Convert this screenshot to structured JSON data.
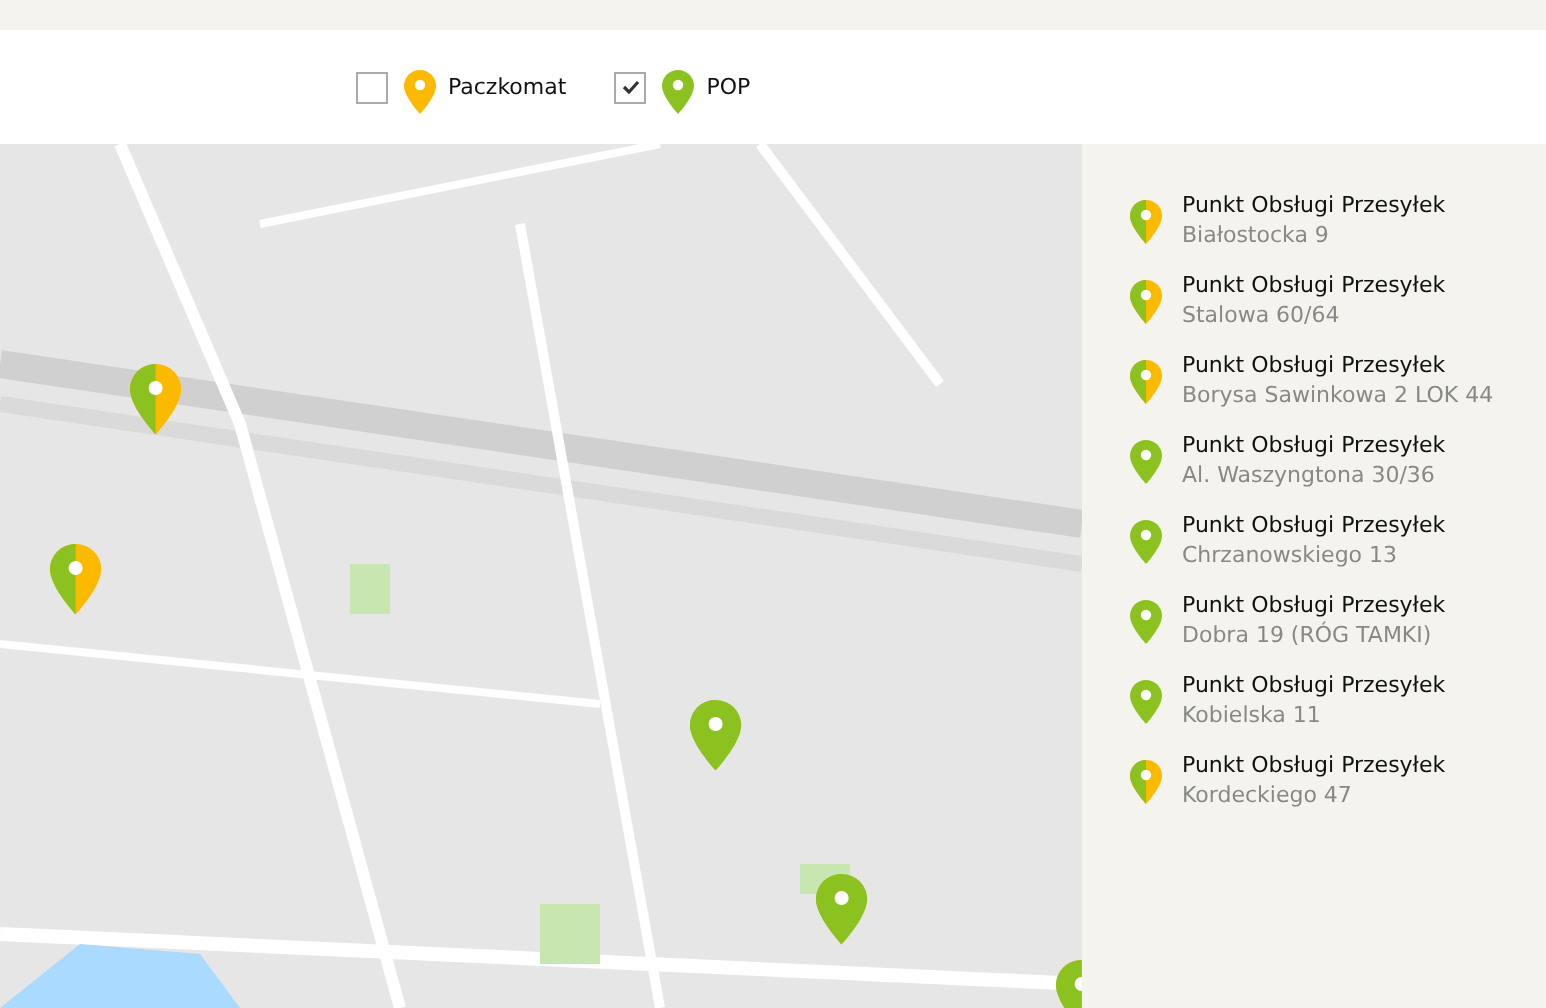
{
  "filters": [
    {
      "label": "Paczkomat",
      "checked": false,
      "kind": "paczkomat"
    },
    {
      "label": "POP",
      "checked": true,
      "kind": "pop"
    }
  ],
  "points": [
    {
      "name": "Punkt Obsługi Przesyłek",
      "address": "Białostocka 9",
      "kind": "mixed"
    },
    {
      "name": "Punkt Obsługi Przesyłek",
      "address": "Stalowa 60/64",
      "kind": "mixed"
    },
    {
      "name": "Punkt Obsługi Przesyłek",
      "address": "Borysa Sawinkowa 2 LOK 44",
      "kind": "mixed"
    },
    {
      "name": "Punkt Obsługi Przesyłek",
      "address": "Al. Waszyngtona 30/36",
      "kind": "pop"
    },
    {
      "name": "Punkt Obsługi Przesyłek",
      "address": "Chrzanowskiego 13",
      "kind": "pop"
    },
    {
      "name": "Punkt Obsługi Przesyłek",
      "address": "Dobra 19 (RÓG TAMKI)",
      "kind": "pop"
    },
    {
      "name": "Punkt Obsługi Przesyłek",
      "address": "Kobielska 11",
      "kind": "pop"
    },
    {
      "name": "Punkt Obsługi Przesyłek",
      "address": "Kordeckiego 47",
      "kind": "mixed"
    }
  ]
}
